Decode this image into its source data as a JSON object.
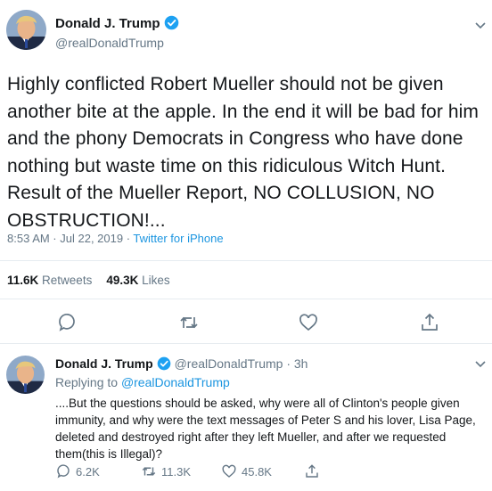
{
  "main_tweet": {
    "author_name": "Donald J. Trump",
    "handle": "@realDonaldTrump",
    "text": "Highly conflicted Robert Mueller should not be given another bite at the apple. In the end it will be bad for him and the phony Democrats in Congress who have done nothing but waste time on this ridiculous Witch Hunt. Result of the Mueller Report, NO COLLUSION, NO OBSTRUCTION!...",
    "timestamp": "8:53 AM · Jul 22, 2019 · ",
    "source": "Twitter for iPhone",
    "retweets_count": "11.6K",
    "retweets_label": "Retweets",
    "likes_count": "49.3K",
    "likes_label": "Likes",
    "actions": [
      "reply-icon",
      "retweet-icon",
      "like-icon",
      "share-icon"
    ]
  },
  "reply_tweet": {
    "author_name": "Donald J. Trump",
    "handle_time": "@realDonaldTrump · 3h",
    "replying_prefix": "Replying to ",
    "replying_to": "@realDonaldTrump",
    "text": "....But the questions should be asked, why were all of Clinton's people given immunity, and why were the text messages of Peter S and his lover, Lisa Page, deleted and destroyed right after they left Mueller, and after we requested them(this is Illegal)?",
    "reply_count": "6.2K",
    "retweet_count": "11.3K",
    "like_count": "45.8K"
  },
  "colors": {
    "text": "#14171a",
    "secondary": "#657786",
    "link": "#1b95e0",
    "divider": "#e6ecf0",
    "verified": "#1da1f2"
  }
}
